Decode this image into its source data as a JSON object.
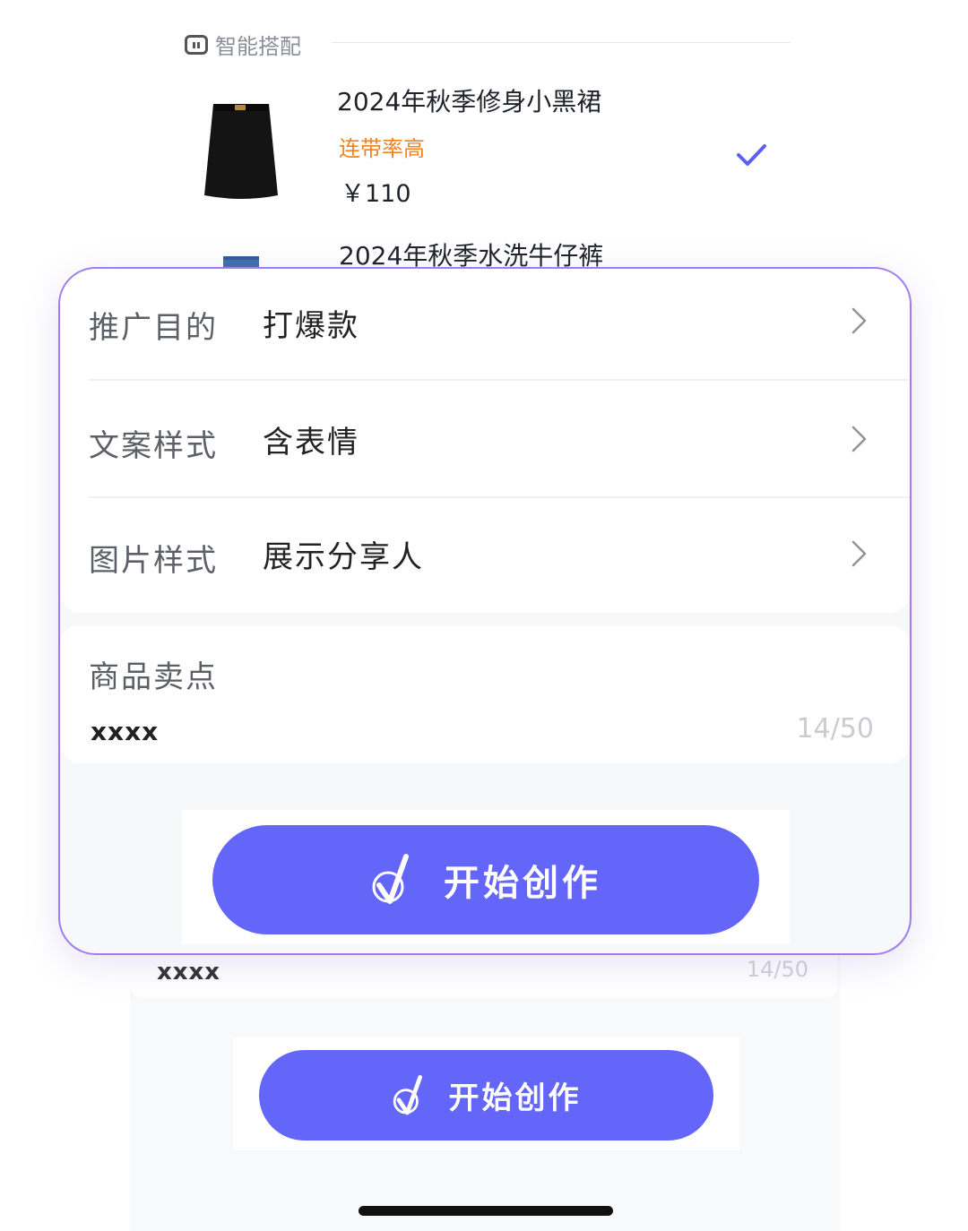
{
  "smart_match": {
    "title": "智能搭配"
  },
  "products": [
    {
      "name": "2024年秋季修身小黑裙",
      "tag": "连带率高",
      "price": "￥110",
      "selected": true
    },
    {
      "name": "2024年秋季水洗牛仔裤"
    }
  ],
  "options": [
    {
      "label": "推广目的",
      "value": "打爆款"
    },
    {
      "label": "文案样式",
      "value": "含表情"
    },
    {
      "label": "图片样式",
      "value": "展示分享人"
    }
  ],
  "selling_point": {
    "label": "商品卖点",
    "value": "xxxx",
    "counter": "14/50"
  },
  "start_button": {
    "label": "开始创作"
  },
  "background": {
    "selling_value": "xxxx",
    "counter": "14/50",
    "button_label": "开始创作"
  },
  "colors": {
    "accent": "#6366f8",
    "sheet_border": "#a07cf0",
    "tag": "#f5821f"
  }
}
